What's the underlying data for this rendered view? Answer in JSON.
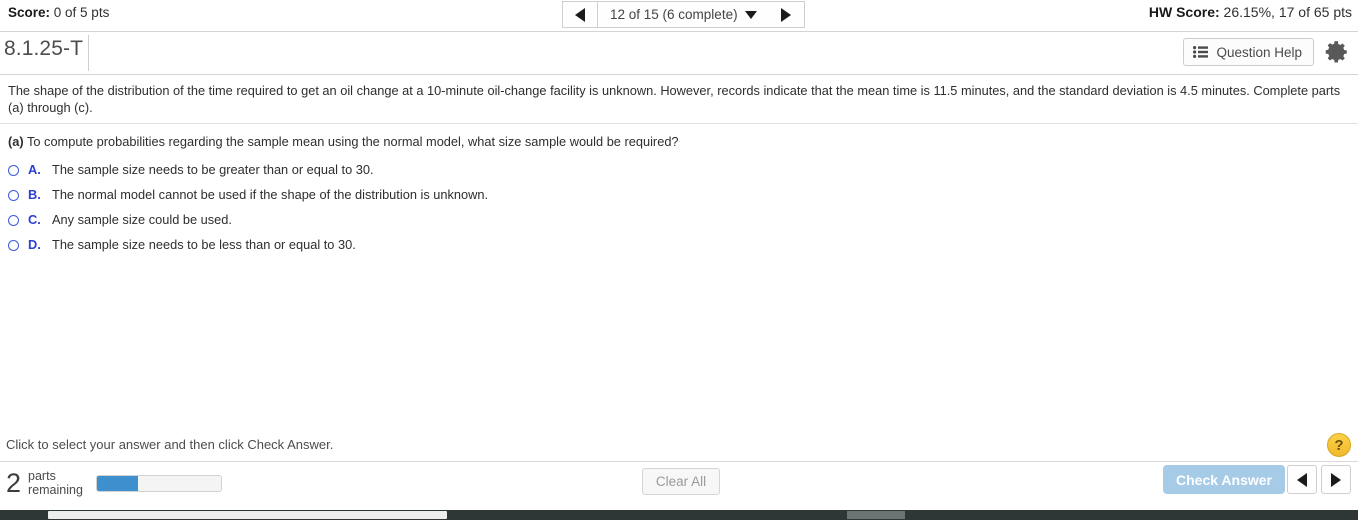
{
  "scorebar": {
    "score_label": "Score:",
    "score_value": " 0 of 5 pts",
    "hw_label": "HW Score:",
    "hw_value": " 26.15%, 17 of 65 pts",
    "pager_text": "12 of 15 (6 complete)",
    "prev_icon": "triangle-left-icon",
    "next_icon": "triangle-right-icon",
    "dropdown_icon": "triangle-down-icon"
  },
  "titlerow": {
    "question_id": "8.1.25-T",
    "question_help_label": "Question Help",
    "question_help_icon": "list-icon",
    "settings_icon": "gear-icon"
  },
  "problem": {
    "stem": "The shape of the distribution of the time required to get an oil change at a 10-minute oil-change facility is unknown. However, records indicate that the mean time is 11.5 minutes, and the standard deviation is 4.5 minutes. Complete parts (a) through (c).",
    "stem_part_a": "(a)",
    "stem_part_c": "(c)",
    "part_label": "(a)",
    "part_question": "To compute probabilities regarding the sample mean using the normal model, what size sample would be required?",
    "choices": [
      {
        "letter": "A.",
        "text": "The sample size needs to be greater than or equal to 30.",
        "selected": false
      },
      {
        "letter": "B.",
        "text": "The normal model cannot be used if the shape of the distribution is unknown.",
        "selected": false
      },
      {
        "letter": "C.",
        "text": "Any sample size could be used.",
        "selected": false
      },
      {
        "letter": "D.",
        "text": "The sample size needs to be less than or equal to 30.",
        "selected": false
      }
    ]
  },
  "hint": {
    "text": "Click to select your answer and then click Check Answer.",
    "help_glyph": "?",
    "help_icon": "question-mark-help-icon"
  },
  "bottom": {
    "parts_count": "2",
    "parts_label_line1": "parts",
    "parts_label_line2": "remaining",
    "progress_percent": 33,
    "clear_all_label": "Clear All",
    "check_answer_label": "Check Answer",
    "prev_icon": "triangle-left-icon",
    "next_icon": "triangle-right-icon"
  },
  "colors": {
    "accent_blue": "#3d8fcd",
    "check_answer_disabled": "#a6cbe6",
    "choice_blue": "#2b3ed1",
    "help_yellow": "#f0b92c",
    "scrollbar_track": "#2e3735"
  }
}
